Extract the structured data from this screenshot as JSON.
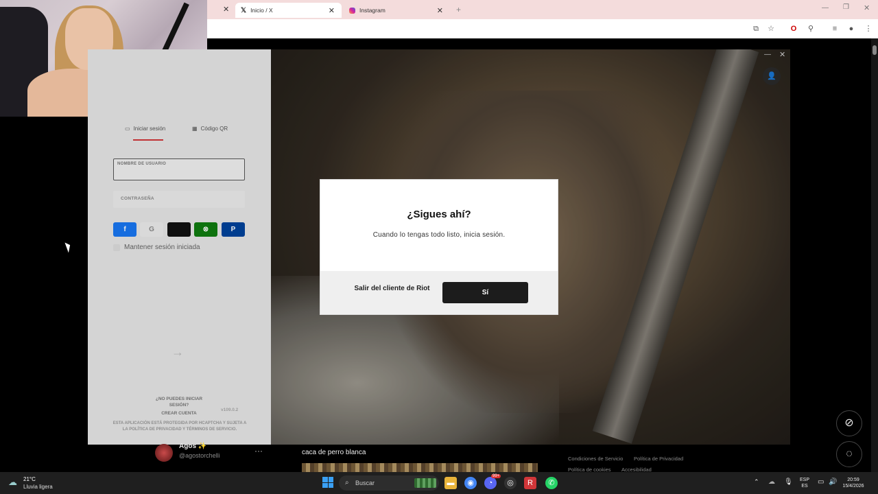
{
  "browser": {
    "tabs": [
      {
        "label": "Inicio / X",
        "active": true
      },
      {
        "label": "Instagram",
        "active": false
      }
    ]
  },
  "riot": {
    "login_tab": "Iniciar sesión",
    "qr_tab": "Código QR",
    "username_label": "NOMBRE DE USUARIO",
    "password_label": "CONTRASEÑA",
    "keep_session": "Mantener sesión iniciada",
    "cant_login": "¿NO PUEDES INICIAR SESIÓN?",
    "create_account": "CREAR CUENTA",
    "version": "v109.0.2",
    "captcha_note": "ESTA APLICACIÓN ESTÁ PROTEGIDA POR HCAPTCHA Y SUJETA A LA POLÍTICA DE PRIVACIDAD Y TÉRMINOS DE SERVICIO.",
    "social_logins": [
      "facebook",
      "google",
      "apple",
      "xbox",
      "playstation"
    ]
  },
  "modal": {
    "title": "¿Sigues ahí?",
    "message": "Cuando lo tengas todo listo, inicia sesión.",
    "exit_label": "Salir del cliente de Riot",
    "yes_label": "Sí"
  },
  "twitter": {
    "user_name": "Agos ✨",
    "user_handle": "@agostorchelli",
    "post_text": "caca de perro blanca",
    "links": [
      "Condiciones de Servicio",
      "Política de Privacidad",
      "Política de cookies",
      "Accesibilidad"
    ]
  },
  "taskbar": {
    "weather_temp": "21°C",
    "weather_desc": "Lluvia ligera",
    "search_placeholder": "Buscar",
    "lang_top": "ESP",
    "lang_bottom": "ES",
    "time": "20:59",
    "date": "15/4/2026",
    "discord_badge": "99+"
  },
  "colors": {
    "accent_red": "#d13639",
    "yes_button": "#1c1c1c"
  }
}
